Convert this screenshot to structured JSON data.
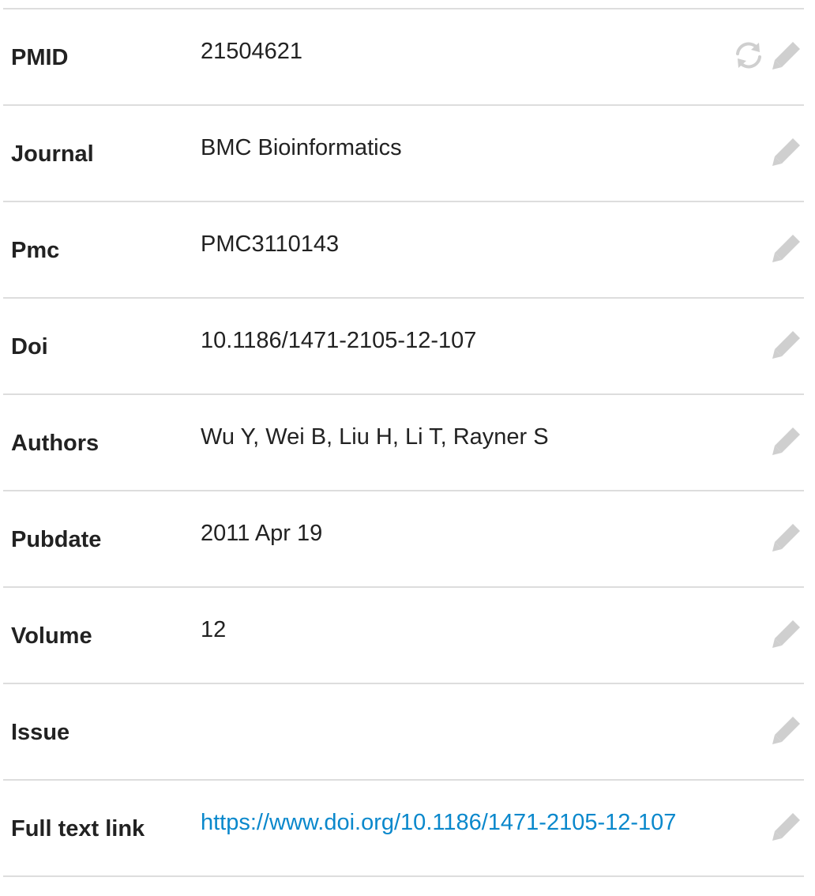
{
  "fields": [
    {
      "label": "PMID",
      "value": "21504621",
      "is_link": false,
      "has_refresh": true,
      "icons": {
        "refresh": "refresh-icon",
        "edit": "pencil-icon"
      }
    },
    {
      "label": "Journal",
      "value": "BMC Bioinformatics",
      "is_link": false,
      "has_refresh": false,
      "icons": {
        "edit": "pencil-icon"
      }
    },
    {
      "label": "Pmc",
      "value": "PMC3110143",
      "is_link": false,
      "has_refresh": false,
      "icons": {
        "edit": "pencil-icon"
      }
    },
    {
      "label": "Doi",
      "value": "10.1186/1471-2105-12-107",
      "is_link": false,
      "has_refresh": false,
      "icons": {
        "edit": "pencil-icon"
      }
    },
    {
      "label": "Authors",
      "value": "Wu Y, Wei B, Liu H, Li T, Rayner S",
      "is_link": false,
      "has_refresh": false,
      "icons": {
        "edit": "pencil-icon"
      }
    },
    {
      "label": "Pubdate",
      "value": "2011 Apr 19",
      "is_link": false,
      "has_refresh": false,
      "icons": {
        "edit": "pencil-icon"
      }
    },
    {
      "label": "Volume",
      "value": "12",
      "is_link": false,
      "has_refresh": false,
      "icons": {
        "edit": "pencil-icon"
      }
    },
    {
      "label": "Issue",
      "value": "",
      "is_link": false,
      "has_refresh": false,
      "icons": {
        "edit": "pencil-icon"
      }
    },
    {
      "label": "Full text link",
      "value": "https://www.doi.org/10.1186/1471-2105-12-107",
      "is_link": true,
      "has_refresh": false,
      "icons": {
        "edit": "pencil-icon"
      }
    }
  ],
  "colors": {
    "link": "#0a88cc",
    "icon": "#cfcfcf",
    "divider": "#dddddd",
    "text": "#222222"
  }
}
